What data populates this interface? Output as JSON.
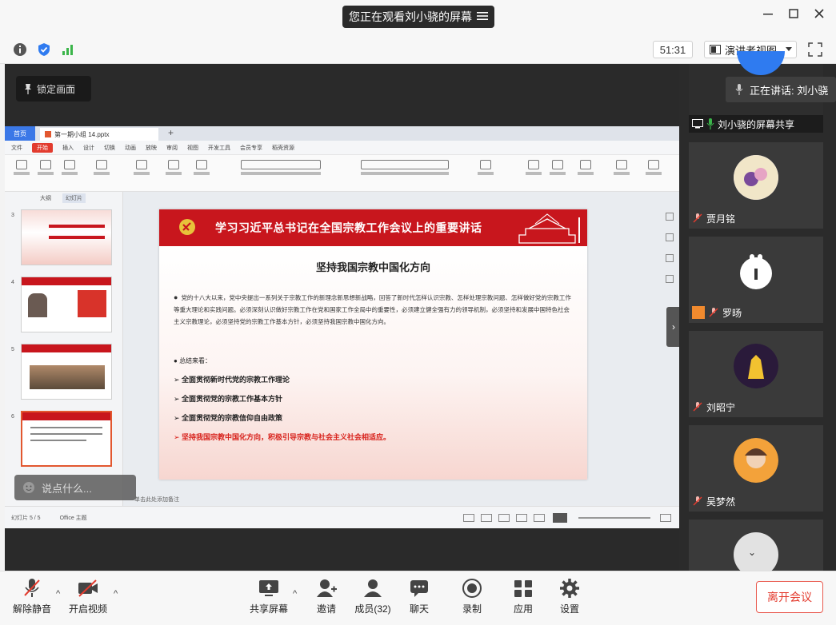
{
  "window": {
    "watching_label": "您正在观看刘小骁的屏幕",
    "min_icon": "minimize-icon",
    "max_icon": "maximize-icon",
    "close_icon": "close-icon"
  },
  "topbar": {
    "timer": "51:31",
    "view_mode": "演讲者视图"
  },
  "share": {
    "lock_label": "锁定画面",
    "chat_prompt": "说点什么..."
  },
  "wps": {
    "home_tab": "首页",
    "doc_tab": "第一期小组 14.pptx",
    "menu": [
      "文件",
      "开始",
      "插入",
      "设计",
      "切换",
      "动画",
      "放映",
      "审阅",
      "视图",
      "开发工具",
      "会员专享",
      "稻壳资源"
    ],
    "menu_active": "开始",
    "side_tabs": [
      "大纲",
      "幻灯片"
    ],
    "thumbs": [
      "3",
      "4",
      "5",
      "6"
    ],
    "status_left": "幻灯片 5 / 5",
    "status_theme": "Office 主题",
    "notes_hint": "单击此处添加备注"
  },
  "slide": {
    "header_title": "学习习近平总书记在全国宗教工作会议上的重要讲话",
    "subtitle": "坚持我国宗教中国化方向",
    "para": "党的十八大以来，党中央提出一系列关于宗教工作的新理念新思想新战略，回答了新时代怎样认识宗教、怎样处理宗教问题、怎样做好党的宗教工作等重大理论和实践问题。必须深刻认识做好宗教工作在党和国家工作全局中的重要性，必须建立健全强有力的领导机制，必须坚持和发展中国特色社会主义宗教理论，必须坚持党的宗教工作基本方针，必须坚持我国宗教中国化方向。",
    "summary_label": "总结来看：",
    "points": [
      "全面贯彻新时代党的宗教工作理论",
      "全面贯彻党的宗教工作基本方针",
      "全面贯彻党的宗教信仰自由政策"
    ],
    "red_point": "坚持我国宗教中国化方向，积极引导宗教与社会主义社会相适应。",
    "accent": "#c8161d"
  },
  "panel": {
    "speaking": "正在讲话: 刘小骁",
    "share_name": "刘小骁的屏幕共享",
    "participants": [
      "贾月铭",
      "罗旸",
      "刘昭宁",
      "吴梦然"
    ]
  },
  "bottombar": {
    "unmute": "解除静音",
    "video": "开启视频",
    "share": "共享屏幕",
    "invite": "邀请",
    "members": "成员(32)",
    "chat": "聊天",
    "record": "录制",
    "apps": "应用",
    "settings": "设置",
    "leave": "离开会议"
  }
}
